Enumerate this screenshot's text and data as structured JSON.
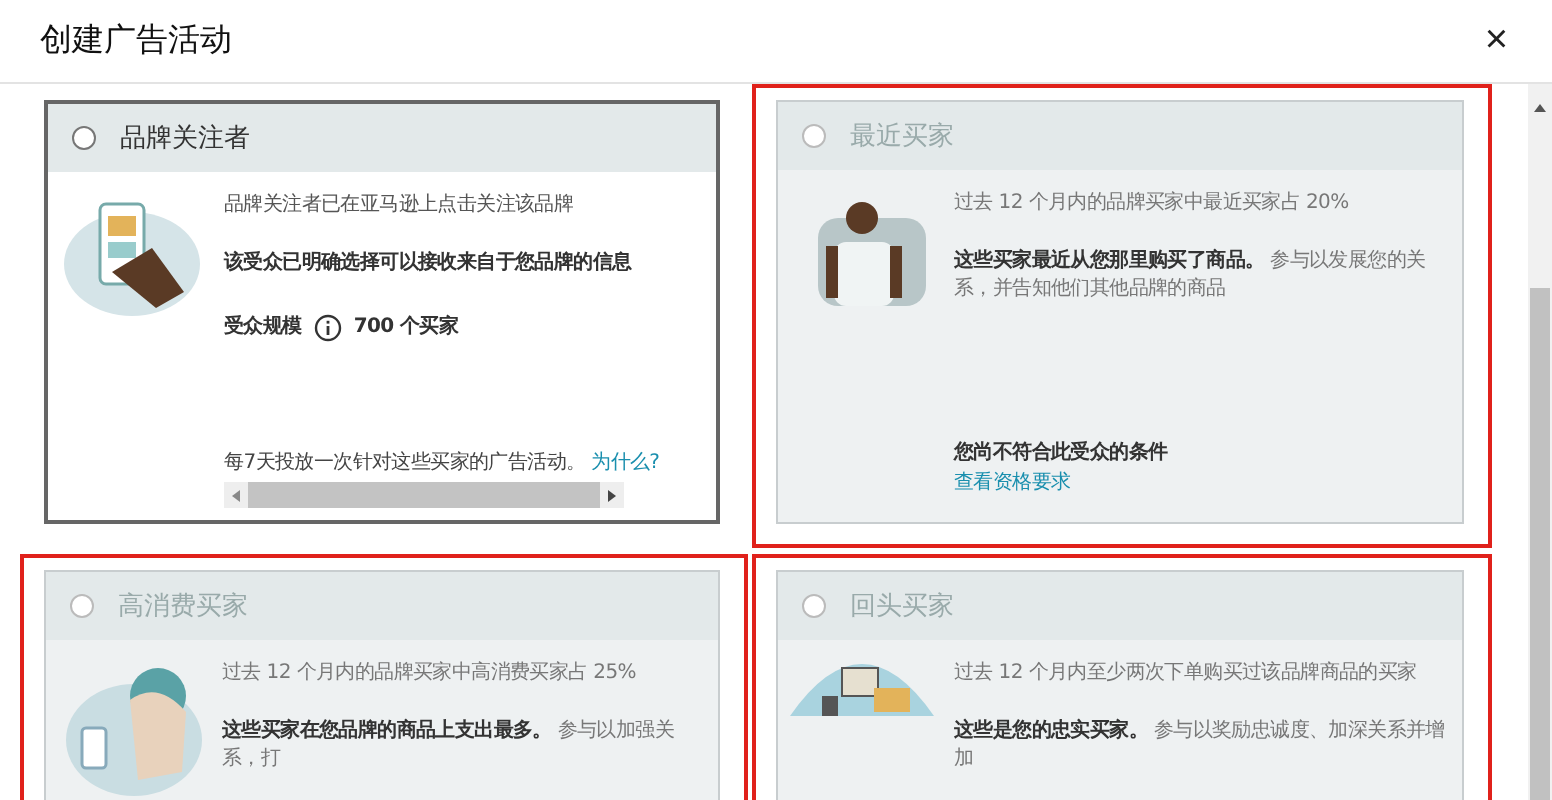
{
  "dialog": {
    "title": "创建广告活动",
    "close": "×"
  },
  "cards": [
    {
      "kind": "follower",
      "title": "品牌关注者",
      "selected": false,
      "disabled": false,
      "highlighted": false,
      "description": "品牌关注者已在亚马逊上点击关注该品牌",
      "note": "该受众已明确选择可以接收来自于您品牌的信息",
      "audience_size": {
        "label": "受众规模",
        "value": "700 个买家"
      },
      "frequency": {
        "text": "每7天投放一次针对这些买家的广告活动。",
        "link": "为什么?"
      }
    },
    {
      "kind": "recent",
      "title": "最近买家",
      "selected": false,
      "disabled": true,
      "highlighted": true,
      "description": "过去 12 个月内的品牌买家中最近买家占 20%",
      "statement": "**这些买家最近从您那里购买了商品。** 参与以发展您的关系，并告知他们其他品牌的商品",
      "eligibility": {
        "text": "您尚不符合此受众的条件",
        "link": "查看资格要求"
      }
    },
    {
      "kind": "high-spend",
      "title": "高消费买家",
      "selected": false,
      "disabled": true,
      "highlighted": true,
      "description": "过去 12 个月内的品牌买家中高消费买家占 25%",
      "statement": "**这些买家在您品牌的商品上支出最多。** 参与以加强关系，打"
    },
    {
      "kind": "repeat",
      "title": "回头买家",
      "selected": false,
      "disabled": true,
      "highlighted": true,
      "description": "过去 12 个月内至少两次下单购买过该品牌商品的买家",
      "statement": "**这些是您的忠实买家。** 参与以奖励忠诚度、加深关系并增加"
    }
  ]
}
